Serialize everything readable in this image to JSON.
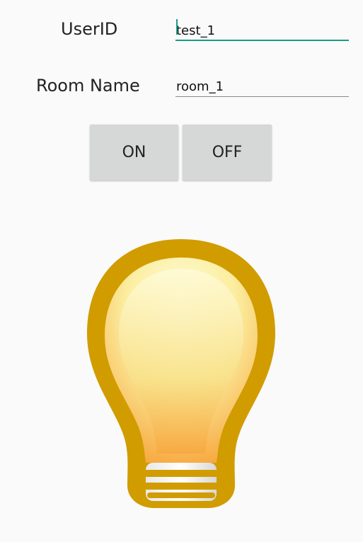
{
  "form": {
    "user_id_label": "UserID",
    "user_id_value": "test_1",
    "room_name_label": "Room Name",
    "room_name_value": "room_1"
  },
  "buttons": {
    "on_label": "ON",
    "off_label": "OFF"
  },
  "bulb": {
    "icon": "lightbulb-icon",
    "state": "on",
    "outline_color": "#d19c00"
  },
  "colors": {
    "accent": "#1a9b8b",
    "button_bg": "#d6d7d7"
  }
}
